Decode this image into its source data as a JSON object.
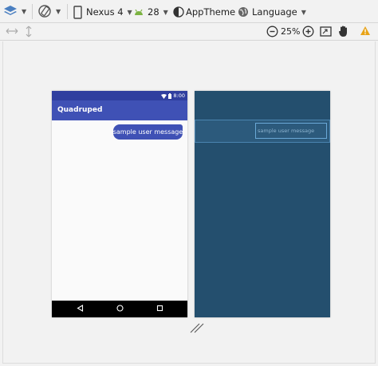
{
  "toolbar": {
    "device_label": "Nexus 4",
    "api_label": "28",
    "theme_label": "AppTheme",
    "language_label": "Language"
  },
  "zoom": {
    "level": "25%"
  },
  "phone": {
    "status_time": "8:00",
    "app_title": "Quadruped",
    "message_text": "sample user message"
  },
  "blueprint": {
    "message_text": "sample user message"
  },
  "colors": {
    "primary": "#3f51b5",
    "primary_dark": "#303f9f",
    "blueprint_bg": "#244f6e",
    "warning": "#e8a317"
  },
  "icons": [
    "layers-icon",
    "rotate-icon",
    "phone-device-icon",
    "android-icon",
    "theme-icon",
    "globe-icon",
    "pan-horizontal-icon",
    "pan-vertical-icon",
    "zoom-out-icon",
    "zoom-in-icon",
    "fit-screen-icon",
    "hand-icon",
    "warning-icon",
    "back-icon",
    "home-icon",
    "recents-icon",
    "resize-handle-icon"
  ]
}
